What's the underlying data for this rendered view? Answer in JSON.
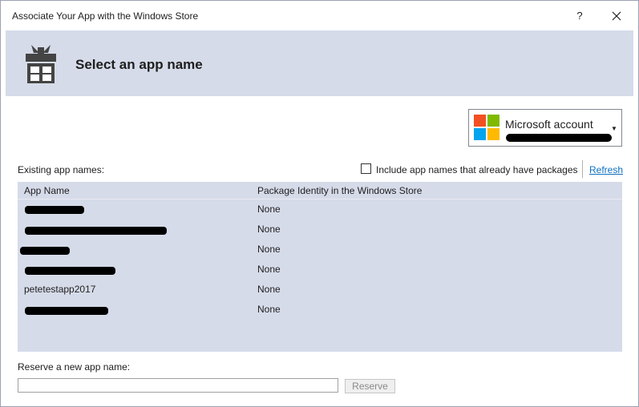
{
  "window": {
    "title": "Associate Your App with the Windows Store",
    "help_label": "?"
  },
  "header": {
    "heading": "Select an app name",
    "icon": "gift-icon"
  },
  "account": {
    "label": "Microsoft account",
    "logo": "microsoft-logo",
    "logo_colors": [
      "#f25022",
      "#7fba00",
      "#00a4ef",
      "#ffb900"
    ]
  },
  "existing": {
    "label": "Existing app names:",
    "include_label": "Include app names that already have packages",
    "include_checked": false,
    "refresh_label": "Refresh"
  },
  "table": {
    "columns": [
      "App Name",
      "Package Identity in the Windows Store"
    ],
    "rows": [
      {
        "name": "",
        "package": "None",
        "redacted": true
      },
      {
        "name": "",
        "package": "None",
        "redacted": true
      },
      {
        "name": "",
        "package": "None",
        "redacted": true
      },
      {
        "name": "",
        "package": "None",
        "redacted": true
      },
      {
        "name": "petetestapp2017",
        "package": "None",
        "redacted": false
      },
      {
        "name": "",
        "package": "None",
        "redacted": true
      }
    ]
  },
  "reserve": {
    "label": "Reserve a new app name:",
    "input_value": "",
    "button_label": "Reserve"
  },
  "colors": {
    "band": "#d6dbe9",
    "link": "#0e70c0"
  }
}
